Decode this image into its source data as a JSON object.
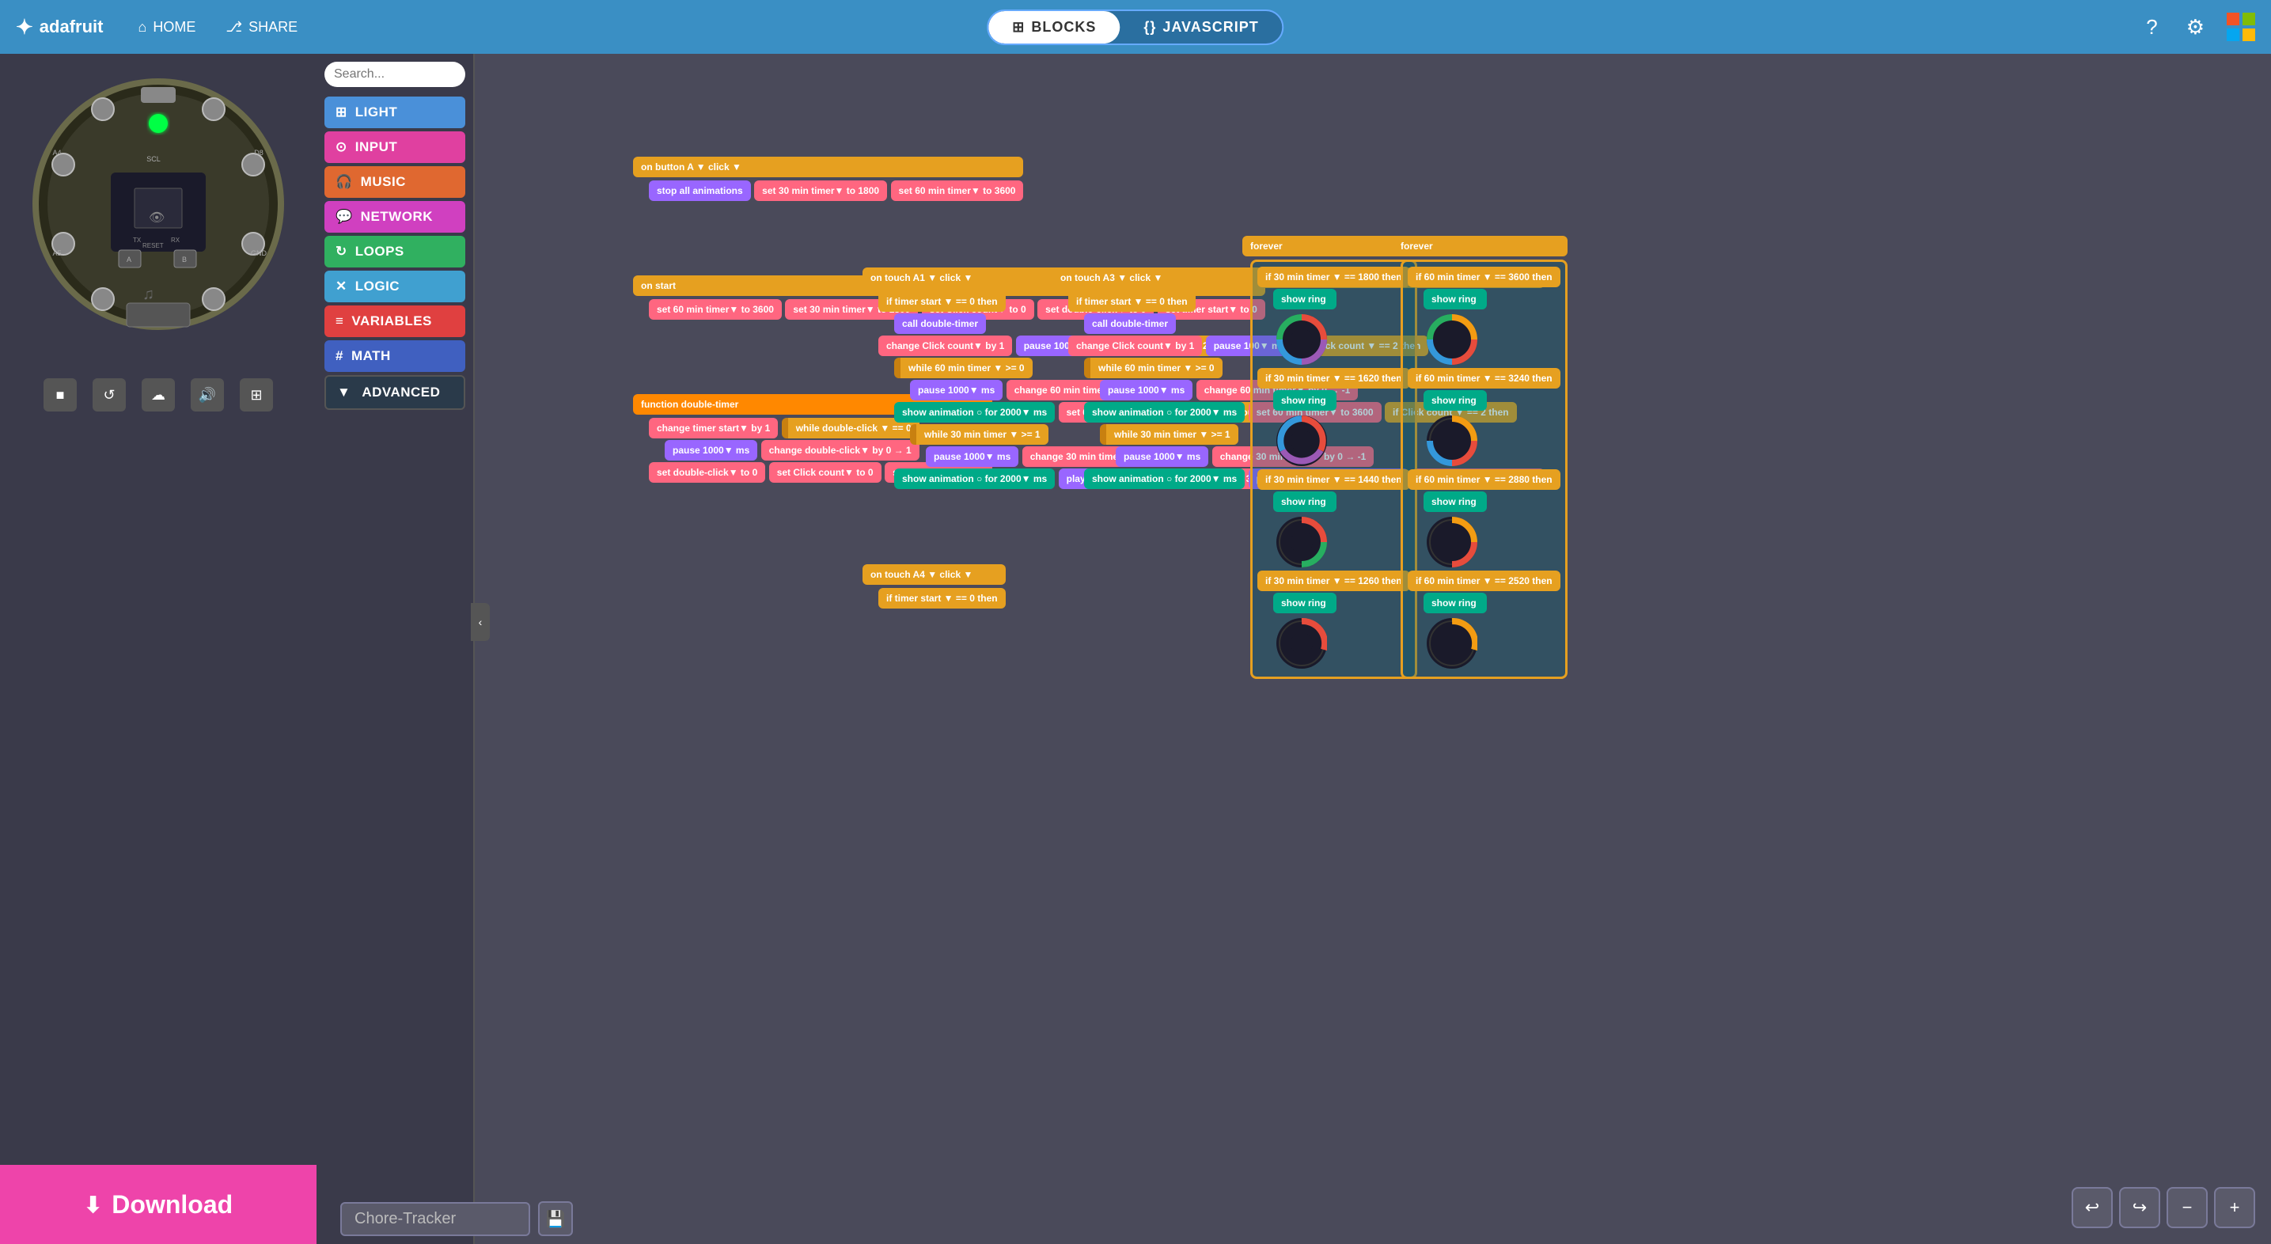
{
  "header": {
    "logo": "adafruit",
    "home_label": "HOME",
    "share_label": "SHARE",
    "tab_blocks": "BLOCKS",
    "tab_javascript": "JAVASCRIPT",
    "active_tab": "blocks"
  },
  "toolbox": {
    "search_placeholder": "Search...",
    "categories": [
      {
        "id": "light",
        "label": "LIGHT",
        "color": "light"
      },
      {
        "id": "input",
        "label": "INPUT",
        "color": "input-cat"
      },
      {
        "id": "music",
        "label": "MUSIC",
        "color": "music"
      },
      {
        "id": "network",
        "label": "NETWORK",
        "color": "network"
      },
      {
        "id": "loops",
        "label": "LOOPS",
        "color": "loops"
      },
      {
        "id": "logic",
        "label": "LOGIC",
        "color": "logic"
      },
      {
        "id": "variables",
        "label": "VARIABLES",
        "color": "variables"
      },
      {
        "id": "math",
        "label": "MATH",
        "color": "math"
      },
      {
        "id": "advanced",
        "label": "ADVANCED",
        "color": "advanced"
      }
    ]
  },
  "project": {
    "name": "Chore-Tracker"
  },
  "controls": {
    "download_label": "Download",
    "undo": "↩",
    "redo": "↪",
    "zoom_out": "−",
    "zoom_in": "+"
  },
  "device": {
    "controls": [
      "■",
      "↺",
      "☁",
      "🔊",
      "⊞"
    ]
  }
}
